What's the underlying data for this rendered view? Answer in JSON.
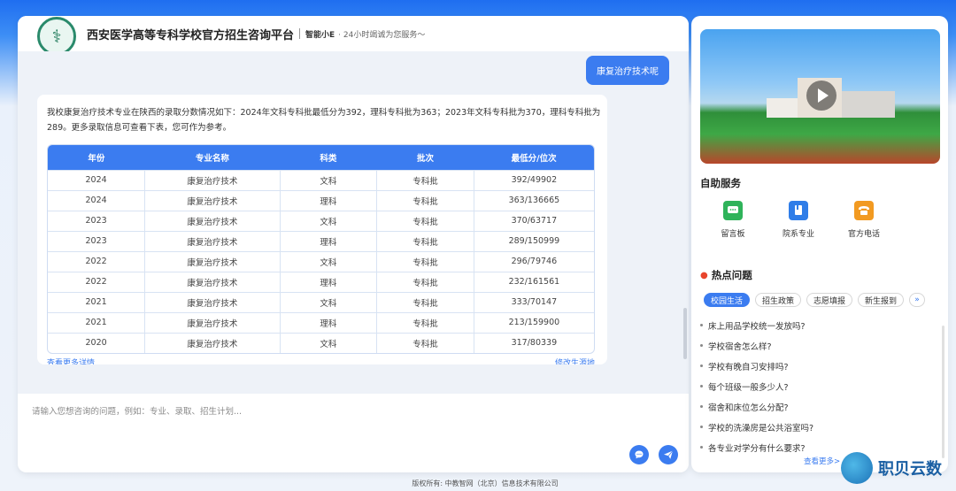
{
  "header": {
    "site_title": "西安医学高等专科学校官方招生咨询平台",
    "brand": "智能小E",
    "tagline": "· 24小时竭诚为您服务～"
  },
  "chat": {
    "user_message": "康复治疗技术呢",
    "bot_message": "我校康复治疗技术专业在陕西的录取分数情况如下：2024年文科专科批最低分为392，理科专科批为363；2023年文科专科批为370，理科专科批为289。更多录取信息可查看下表，您可作为参考。",
    "table": {
      "headers": [
        "年份",
        "专业名称",
        "科类",
        "批次",
        "最低分/位次"
      ],
      "rows": [
        [
          "2024",
          "康复治疗技术",
          "文科",
          "专科批",
          "392/49902"
        ],
        [
          "2024",
          "康复治疗技术",
          "理科",
          "专科批",
          "363/136665"
        ],
        [
          "2023",
          "康复治疗技术",
          "文科",
          "专科批",
          "370/63717"
        ],
        [
          "2023",
          "康复治疗技术",
          "理科",
          "专科批",
          "289/150999"
        ],
        [
          "2022",
          "康复治疗技术",
          "文科",
          "专科批",
          "296/79746"
        ],
        [
          "2022",
          "康复治疗技术",
          "理科",
          "专科批",
          "232/161561"
        ],
        [
          "2021",
          "康复治疗技术",
          "文科",
          "专科批",
          "333/70147"
        ],
        [
          "2021",
          "康复治疗技术",
          "理科",
          "专科批",
          "213/159900"
        ],
        [
          "2020",
          "康复治疗技术",
          "文科",
          "专科批",
          "317/80339"
        ]
      ]
    },
    "more_link": "查看更多详情",
    "edit_link": "修改生源地"
  },
  "input": {
    "placeholder": "请输入您想咨询的问题，例如：专业、录取、招生计划..."
  },
  "side": {
    "services_title": "自助服务",
    "services": [
      {
        "label": "留言板",
        "icon": "message-board-icon",
        "color": "#2fb35a"
      },
      {
        "label": "院系专业",
        "icon": "book-icon",
        "color": "#2f7de8"
      },
      {
        "label": "官方电话",
        "icon": "phone-icon",
        "color": "#f29a21"
      }
    ],
    "hot_title": "热点问题",
    "tabs": [
      "校园生活",
      "招生政策",
      "志愿填报",
      "新生报到"
    ],
    "questions": [
      "床上用品学校统一发放吗?",
      "学校宿舍怎么样?",
      "学校有晚自习安排吗?",
      "每个班级一般多少人?",
      "宿舍和床位怎么分配?",
      "学校的洗澡房是公共浴室吗?",
      "各专业对学分有什么要求?"
    ],
    "see_more": "查看更多>"
  },
  "footer": {
    "text": "版权所有: 中教智网（北京）信息技术有限公司"
  },
  "watermark": {
    "text": "职贝云数"
  }
}
